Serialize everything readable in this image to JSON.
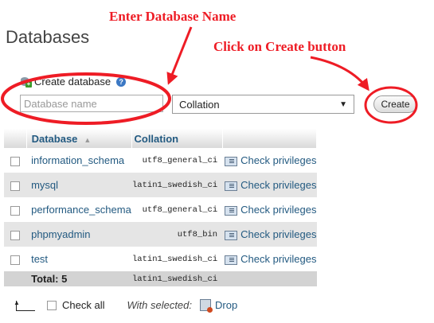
{
  "page": {
    "title": "Databases"
  },
  "annotations": {
    "enter_name": "Enter Database Name",
    "click_create": "Click on Create button",
    "color": "#ee1c25"
  },
  "create_db": {
    "label": "Create database",
    "help_icon": "help-icon",
    "name_placeholder": "Database name",
    "name_value": "",
    "collation_selected": "Collation",
    "create_label": "Create"
  },
  "table": {
    "headers": {
      "database": "Database",
      "collation": "Collation"
    },
    "rows": [
      {
        "name": "information_schema",
        "collation": "utf8_general_ci",
        "action": "Check privileges"
      },
      {
        "name": "mysql",
        "collation": "latin1_swedish_ci",
        "action": "Check privileges"
      },
      {
        "name": "performance_schema",
        "collation": "utf8_general_ci",
        "action": "Check privileges"
      },
      {
        "name": "phpmyadmin",
        "collation": "utf8_bin",
        "action": "Check privileges"
      },
      {
        "name": "test",
        "collation": "latin1_swedish_ci",
        "action": "Check privileges"
      }
    ],
    "total_label": "Total: 5",
    "total_collation": "latin1_swedish_ci"
  },
  "footer": {
    "check_all": "Check all",
    "with_selected": "With selected:",
    "drop": "Drop"
  },
  "colors": {
    "link": "#235a81",
    "annotation": "#ee1c25"
  }
}
